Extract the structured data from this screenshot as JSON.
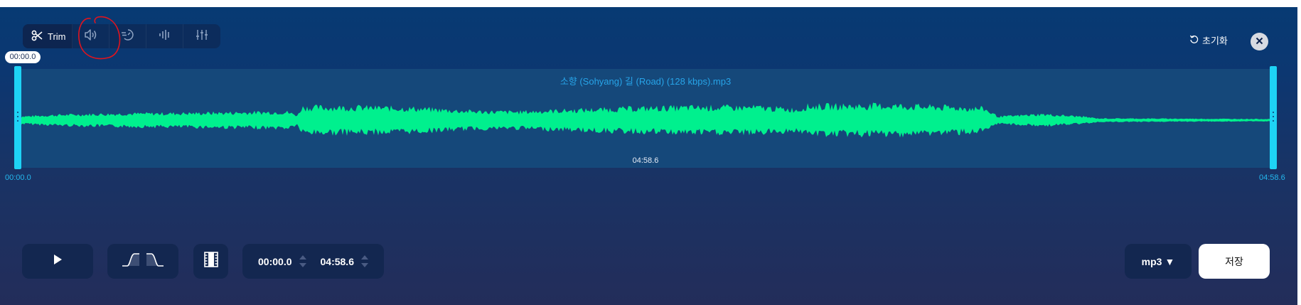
{
  "toolbar": {
    "trim_label": "Trim",
    "tools": [
      {
        "icon": "scissors-icon",
        "active": true
      },
      {
        "icon": "volume-icon",
        "active": false
      },
      {
        "icon": "speed-icon",
        "active": false
      },
      {
        "icon": "pitch-icon",
        "active": false
      },
      {
        "icon": "equalizer-icon",
        "active": false
      }
    ],
    "annotation_color": "#e0141e"
  },
  "header": {
    "reset_label": "초기화",
    "close_icon": "close-icon"
  },
  "waveform": {
    "file_name": "소향 (Sohyang) 길 (Road) (128 kbps).mp3",
    "playhead_time": "00:00.0",
    "center_time": "04:58.6",
    "range_start": "00:00.0",
    "range_end": "04:58.6",
    "wave_color": "#00f08e",
    "handle_color": "#1ed3f5"
  },
  "controls": {
    "play_icon": "play-icon",
    "fade_in_icon": "fade-in-icon",
    "fade_out_icon": "fade-out-icon",
    "trim_mode_icon": "film-trim-icon",
    "start_time": "00:00.0",
    "end_time": "04:58.6",
    "format": "mp3",
    "format_caret": "▼",
    "save_label": "저장"
  }
}
